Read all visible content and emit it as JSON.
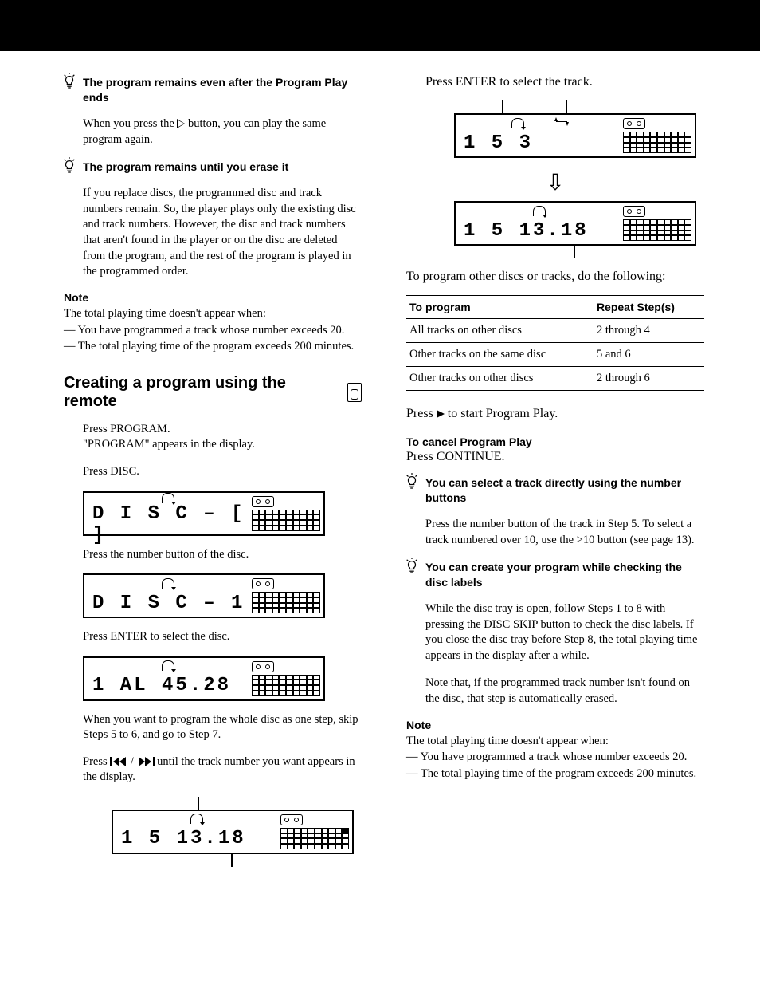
{
  "left": {
    "tip1": {
      "head": "The program remains even after the Program Play ends",
      "body_a": "When you press the ",
      "body_b": " button, you can play the same program again."
    },
    "tip2": {
      "head": "The program remains until you erase it",
      "body": "If you replace discs, the programmed disc and track numbers remain. So, the player plays only the existing disc and track numbers. However, the disc and track numbers that aren't found in the player or on the disc are deleted from the program, and the rest of the program is played in the programmed order."
    },
    "note_head": "Note",
    "note_l1": "The total playing time doesn't appear when:",
    "note_l2": "— You have programmed a track whose number exceeds 20.",
    "note_l3": "— The total playing time of the program exceeds 200 minutes.",
    "h2": "Creating a program using the remote",
    "step1a": "Press PROGRAM.",
    "step1b": "\"PROGRAM\" appears in the display.",
    "step2": "Press DISC.",
    "lcd1": "D I S C – [   ]",
    "step3": "Press the number button of the disc.",
    "lcd2": "D I S C –  1 ",
    "step4": "Press ENTER to select the disc.",
    "lcd3": " 1  AL  45.28",
    "para_skip": "When you want to program the whole disc as one step, skip Steps 5 to 6, and go to Step 7.",
    "step5a": "Press ",
    "step5b": " until the track number you want appears in the display.",
    "lcd4": " 1   5  13.18"
  },
  "right": {
    "step6": "Press ENTER to select the track.",
    "lcd5": " 1   5   3",
    "lcd6": " 1   5  13.18",
    "para7": "To program other discs or tracks, do the following:",
    "table": {
      "h1": "To program",
      "h2": "Repeat Step(s)",
      "rows": [
        [
          "All tracks on other discs",
          "2 through 4"
        ],
        [
          "Other tracks on the same disc",
          "5 and 6"
        ],
        [
          "Other tracks on other discs",
          "2 through 6"
        ]
      ]
    },
    "step8a": "Press ",
    "step8b": " to start Program Play.",
    "cancel_h": "To cancel Program Play",
    "cancel_b": "Press CONTINUE.",
    "tip3": {
      "head": "You can select a track directly using the number buttons",
      "body": "Press the number button of the track in Step 5. To select a track numbered over 10, use the >10 button (see page 13)."
    },
    "tip4": {
      "head": "You can create your program while checking the disc labels",
      "body1": "While the disc tray is open, follow Steps 1 to 8 with pressing the DISC SKIP button to check the disc labels. If you close the disc tray before Step 8, the total playing time appears in the display after a while.",
      "body2": "Note that, if the programmed track number isn't found on the disc, that step is automatically erased."
    },
    "note_head": "Note",
    "note_l1": "The total playing time doesn't appear when:",
    "note_l2": "— You have programmed a track whose number exceeds 20.",
    "note_l3": "— The total playing time of the program exceeds 200 minutes."
  }
}
